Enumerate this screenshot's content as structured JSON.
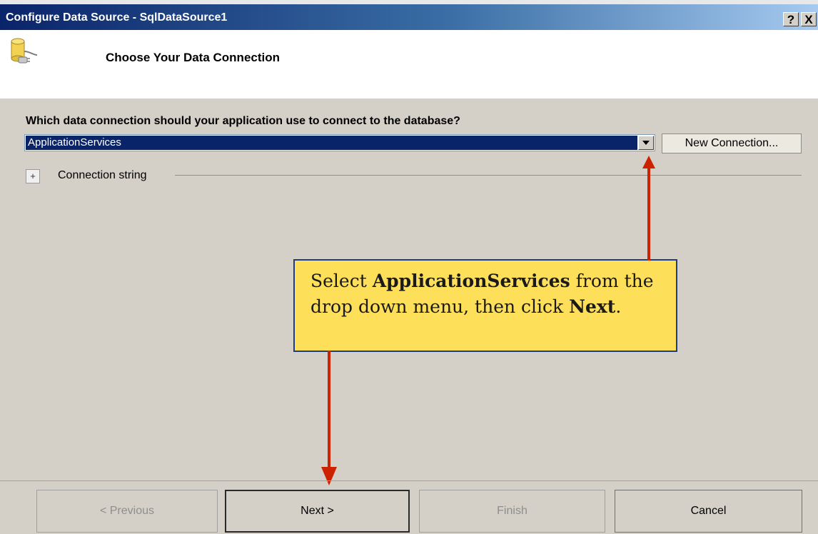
{
  "window": {
    "title": "Configure Data Source - SqlDataSource1",
    "help_button": "?",
    "close_button": "X"
  },
  "header": {
    "title": "Choose Your Data Connection",
    "icon": "database-plug-icon"
  },
  "main": {
    "question": "Which data connection should your application use to connect to the database?",
    "connection_select": {
      "selected_value": "ApplicationServices"
    },
    "new_connection_button": "New Connection...",
    "expander_symbol": "+",
    "connection_string_label": "Connection string"
  },
  "callout": {
    "text_1": "Select ",
    "bold_1": "ApplicationServices",
    "text_2": " from the drop down menu, then click ",
    "bold_2": "Next",
    "text_3": "."
  },
  "footer": {
    "previous": "< Previous",
    "next": "Next >",
    "finish": "Finish",
    "cancel": "Cancel"
  },
  "colors": {
    "title_gradient_start": "#0a246a",
    "selection": "#0a246a",
    "callout_fill": "#fedf5a",
    "callout_border": "#1f3d7a",
    "annotation_arrow": "#cc2200"
  }
}
